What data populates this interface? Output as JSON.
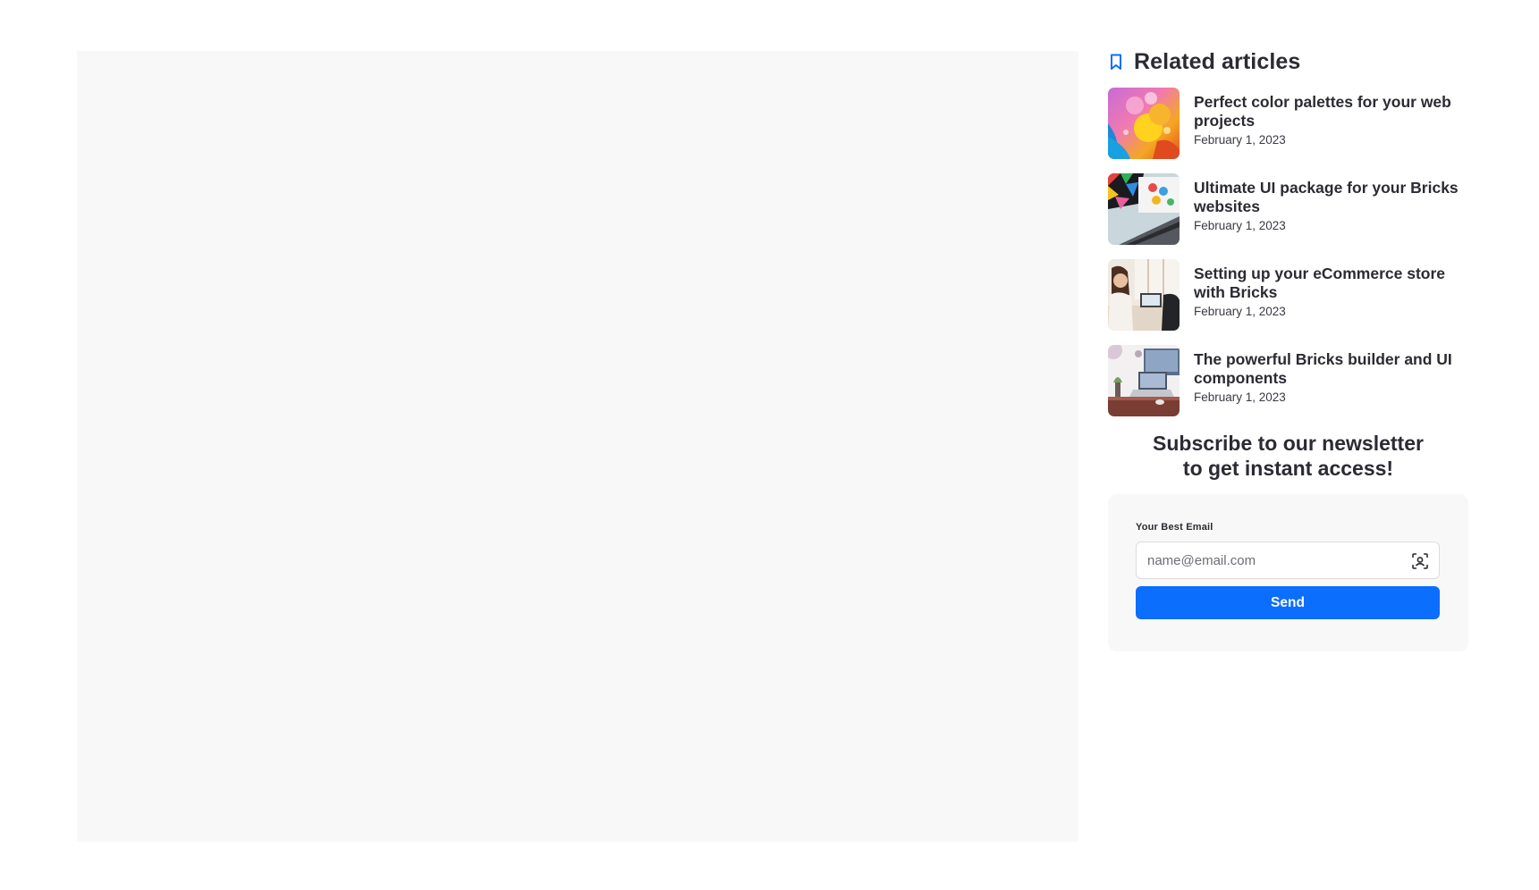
{
  "sidebar": {
    "related": {
      "title": "Related articles",
      "icon": "bookmark-icon",
      "accent": "#0b6efd",
      "articles": [
        {
          "title": "Perfect color palettes for your web projects",
          "date": "February 1, 2023",
          "thumb": "abstract-color-paint-image"
        },
        {
          "title": "Ultimate UI package for your Bricks websites",
          "date": "February 1, 2023",
          "thumb": "laptop-colorful-screen-image"
        },
        {
          "title": "Setting up your eCommerce store with Bricks",
          "date": "February 1, 2023",
          "thumb": "people-at-desk-image"
        },
        {
          "title": "The powerful Bricks builder and UI components",
          "date": "February 1, 2023",
          "thumb": "desk-workspace-image"
        }
      ]
    },
    "newsletter": {
      "heading_line1": "Subscribe to our newsletter",
      "heading_line2": "to get instant access!",
      "email_label": "Your Best Email",
      "email_placeholder": "name@email.com",
      "email_value": "",
      "field_icon": "face-scan-icon",
      "send_label": "Send",
      "button_color": "#0b6efd"
    }
  }
}
